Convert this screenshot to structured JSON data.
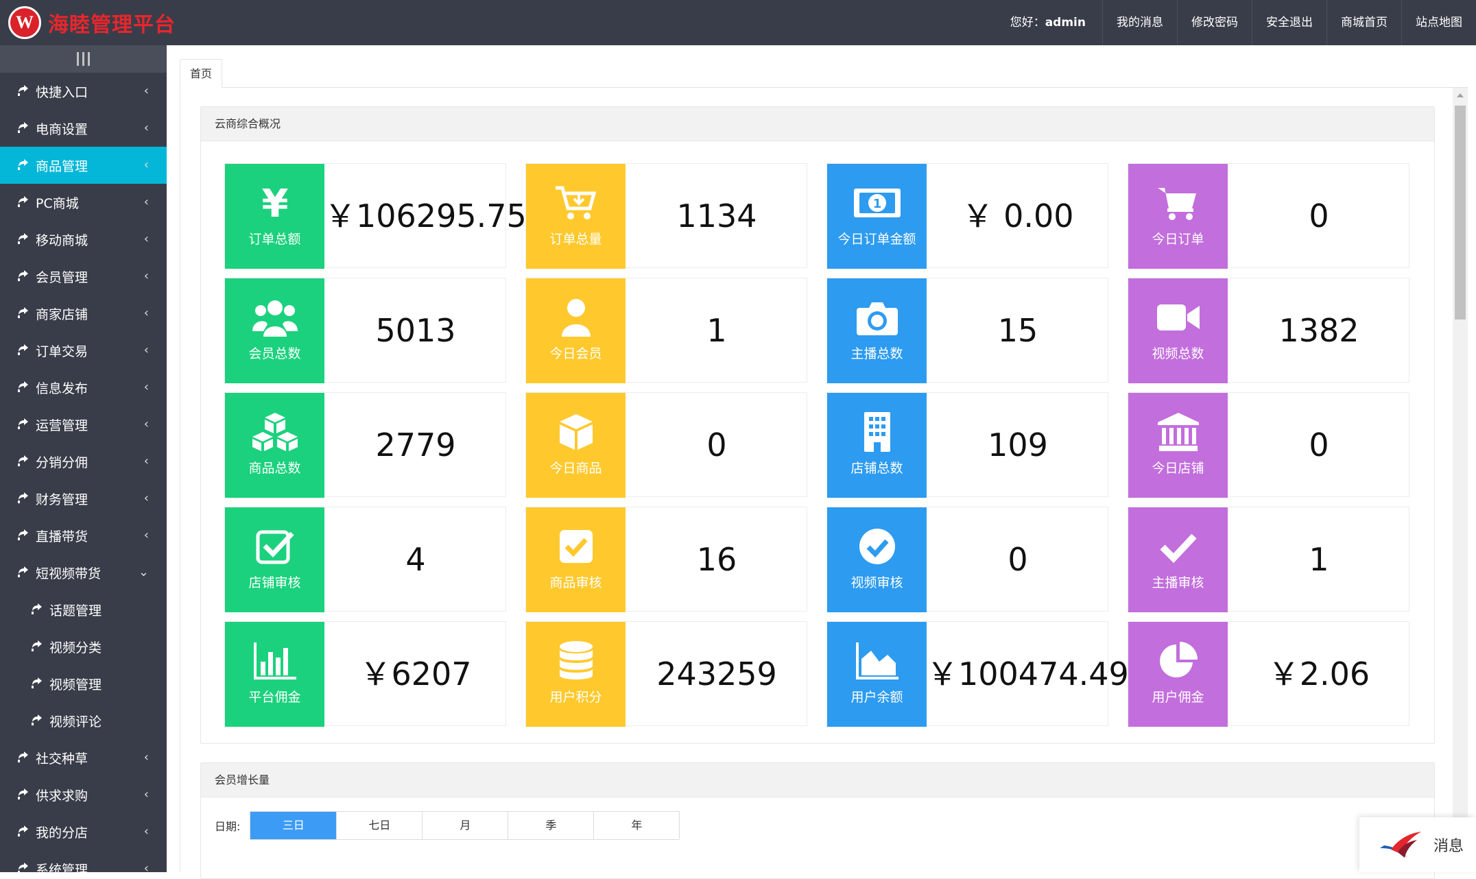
{
  "header": {
    "logo_letter": "W",
    "brand": "海睦管理平台",
    "greeting_prefix": "您好：",
    "username": "admin",
    "nav": [
      "我的消息",
      "修改密码",
      "安全退出",
      "商城首页",
      "站点地图"
    ]
  },
  "sidebar": {
    "items": [
      {
        "label": "快捷入口",
        "chevron": "‹"
      },
      {
        "label": "电商设置",
        "chevron": "‹"
      },
      {
        "label": "商品管理",
        "chevron": "‹"
      },
      {
        "label": "PC商城",
        "chevron": "‹"
      },
      {
        "label": "移动商城",
        "chevron": "‹"
      },
      {
        "label": "会员管理",
        "chevron": "‹"
      },
      {
        "label": "商家店铺",
        "chevron": "‹"
      },
      {
        "label": "订单交易",
        "chevron": "‹"
      },
      {
        "label": "信息发布",
        "chevron": "‹"
      },
      {
        "label": "运营管理",
        "chevron": "‹"
      },
      {
        "label": "分销分佣",
        "chevron": "‹"
      },
      {
        "label": "财务管理",
        "chevron": "‹"
      },
      {
        "label": "直播带货",
        "chevron": "‹"
      },
      {
        "label": "短视频带货",
        "chevron": "⌄"
      },
      {
        "label": "话题管理"
      },
      {
        "label": "视频分类"
      },
      {
        "label": "视频管理"
      },
      {
        "label": "视频评论"
      },
      {
        "label": "社交种草",
        "chevron": "‹"
      },
      {
        "label": "供求求购",
        "chevron": "‹"
      },
      {
        "label": "我的分店",
        "chevron": "‹"
      },
      {
        "label": "系统管理",
        "chevron": "‹"
      }
    ]
  },
  "tabs": [
    "首页"
  ],
  "overview": {
    "title": "云商综合概况",
    "cards": [
      {
        "label": "订单总额",
        "value": "￥106295.75",
        "icon": "yen-icon",
        "color": "#1BD17D"
      },
      {
        "label": "订单总量",
        "value": "1134",
        "icon": "cart-download-icon",
        "color": "#FFC92E"
      },
      {
        "label": "今日订单金额",
        "value": "￥ 0.00",
        "icon": "money-bill-icon",
        "color": "#2D9BF0"
      },
      {
        "label": "今日订单",
        "value": "0",
        "icon": "shopping-cart-icon",
        "color": "#C26EDC"
      },
      {
        "label": "会员总数",
        "value": "5013",
        "icon": "users-icon",
        "color": "#1BD17D"
      },
      {
        "label": "今日会员",
        "value": "1",
        "icon": "user-icon",
        "color": "#FFC92E"
      },
      {
        "label": "主播总数",
        "value": "15",
        "icon": "camera-icon",
        "color": "#2D9BF0"
      },
      {
        "label": "视频总数",
        "value": "1382",
        "icon": "video-camera-icon",
        "color": "#C26EDC"
      },
      {
        "label": "商品总数",
        "value": "2779",
        "icon": "cubes-icon",
        "color": "#1BD17D"
      },
      {
        "label": "今日商品",
        "value": "0",
        "icon": "cube-icon",
        "color": "#FFC92E"
      },
      {
        "label": "店铺总数",
        "value": "109",
        "icon": "building-icon",
        "color": "#2D9BF0"
      },
      {
        "label": "今日店铺",
        "value": "0",
        "icon": "bank-icon",
        "color": "#C26EDC"
      },
      {
        "label": "店铺审核",
        "value": "4",
        "icon": "check-square-outline-icon",
        "color": "#1BD17D"
      },
      {
        "label": "商品审核",
        "value": "16",
        "icon": "check-square-icon",
        "color": "#FFC92E"
      },
      {
        "label": "视频审核",
        "value": "0",
        "icon": "check-circle-icon",
        "color": "#2D9BF0"
      },
      {
        "label": "主播审核",
        "value": "1",
        "icon": "check-icon",
        "color": "#C26EDC"
      },
      {
        "label": "平台佣金",
        "value": "￥6207",
        "icon": "bar-chart-icon",
        "color": "#1BD17D"
      },
      {
        "label": "用户积分",
        "value": "243259",
        "icon": "database-icon",
        "color": "#FFC92E"
      },
      {
        "label": "用户余额",
        "value": "￥100474.49",
        "icon": "area-chart-icon",
        "color": "#2D9BF0"
      },
      {
        "label": "用户佣金",
        "value": "￥2.06",
        "icon": "pie-chart-icon",
        "color": "#C26EDC"
      }
    ]
  },
  "growth": {
    "title": "会员增长量",
    "date_label": "日期:",
    "ranges": [
      "三日",
      "七日",
      "月",
      "季",
      "年"
    ],
    "selected": "三日"
  },
  "message_widget": {
    "label": "消息"
  }
}
